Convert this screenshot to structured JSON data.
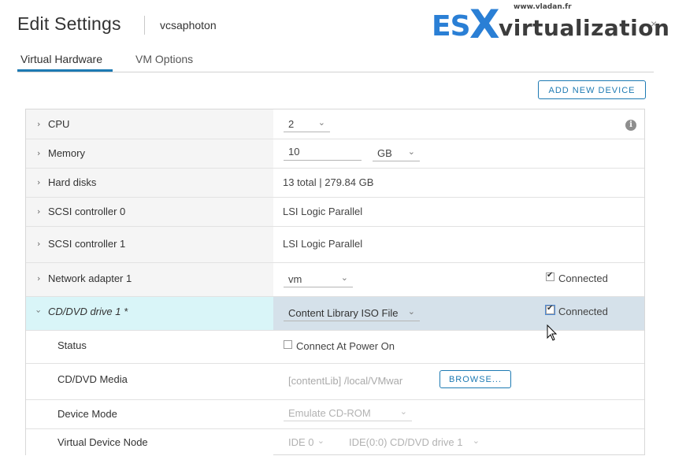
{
  "dialog": {
    "title": "Edit Settings",
    "vm_name": "vcsaphoton",
    "close_glyph": "×"
  },
  "logo": {
    "url_text": "www.vladan.fr",
    "es": "ES",
    "x": "X",
    "rest": "virtualization"
  },
  "tabs": [
    {
      "label": "Virtual Hardware",
      "active": true
    },
    {
      "label": "VM Options",
      "active": false
    }
  ],
  "toolbar": {
    "add_device_label": "ADD NEW DEVICE"
  },
  "hardware": {
    "cpu": {
      "label": "CPU",
      "value": "2"
    },
    "memory": {
      "label": "Memory",
      "value": "10",
      "unit": "GB"
    },
    "hard_disks": {
      "label": "Hard disks",
      "value": "13 total | 279.84 GB"
    },
    "scsi0": {
      "label": "SCSI controller 0",
      "value": "LSI Logic Parallel"
    },
    "scsi1": {
      "label": "SCSI controller 1",
      "value": "LSI Logic Parallel"
    },
    "network": {
      "label": "Network adapter 1",
      "value": "vm",
      "connected_label": "Connected",
      "connected": true
    },
    "cdrom": {
      "label": "CD/DVD drive 1 *",
      "value": "Content Library ISO File",
      "connected_label": "Connected",
      "connected": true,
      "status": {
        "label": "Status",
        "checkbox_label": "Connect At Power On",
        "checked": false
      },
      "media": {
        "label": "CD/DVD Media",
        "value": "[contentLib] /local/VMwar",
        "browse_label": "BROWSE..."
      },
      "device_mode": {
        "label": "Device Mode",
        "value": "Emulate CD-ROM"
      },
      "device_node": {
        "label": "Virtual Device Node",
        "controller": "IDE 0",
        "node": "IDE(0:0) CD/DVD drive 1"
      }
    }
  },
  "icons": {
    "expand": "chevron-right-icon",
    "collapse": "chevron-down-icon",
    "info": "info-icon",
    "cursor": "mouse-pointer-icon"
  },
  "colors": {
    "accent": "#1d7ab3",
    "selected_row_left": "#d9f5f8",
    "selected_row_right": "#d5e1ea",
    "logo_blue": "#2a7fd5"
  }
}
